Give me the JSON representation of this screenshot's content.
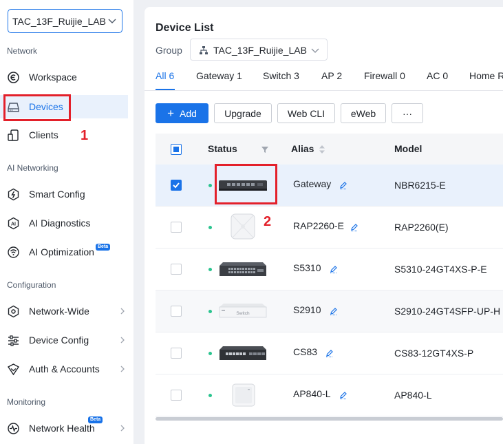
{
  "sidebar": {
    "project": "TAC_13F_Ruijie_LAB",
    "sections": {
      "network": "Network",
      "ai_networking": "AI Networking",
      "configuration": "Configuration",
      "monitoring": "Monitoring"
    },
    "items": {
      "workspace": "Workspace",
      "devices": "Devices",
      "clients": "Clients",
      "smart_config": "Smart Config",
      "ai_diagnostics": "AI Diagnostics",
      "ai_optimization": "AI Optimization",
      "network_wide": "Network-Wide",
      "device_config": "Device Config",
      "auth_accounts": "Auth & Accounts",
      "network_health": "Network Health"
    },
    "beta_label": "Beta"
  },
  "annotations": {
    "step1": "1",
    "step2": "2"
  },
  "main": {
    "title": "Device List",
    "group_label": "Group",
    "group_value": "TAC_13F_Ruijie_LAB",
    "tabs": [
      "All 6",
      "Gateway 1",
      "Switch 3",
      "AP 2",
      "Firewall 0",
      "AC 0",
      "Home R"
    ],
    "active_tab": "All 6",
    "toolbar": {
      "add": "Add",
      "upgrade": "Upgrade",
      "web_cli": "Web CLI",
      "eweb": "eWeb",
      "more": "···"
    },
    "columns": {
      "status": "Status",
      "alias": "Alias",
      "model": "Model"
    },
    "rows": [
      {
        "alias": "Gateway",
        "model": "NBR6215-E",
        "online": true,
        "checked": true,
        "device_type": "gateway"
      },
      {
        "alias": "RAP2260-E",
        "model": "RAP2260(E)",
        "online": true,
        "checked": false,
        "device_type": "ap-ceiling"
      },
      {
        "alias": "S5310",
        "model": "S5310-24GT4XS-P-E",
        "online": true,
        "checked": false,
        "device_type": "switch-dark"
      },
      {
        "alias": "S2910",
        "model": "S2910-24GT4SFP-UP-H",
        "online": true,
        "checked": false,
        "device_type": "switch-white"
      },
      {
        "alias": "CS83",
        "model": "CS83-12GT4XS-P",
        "online": true,
        "checked": false,
        "device_type": "switch-dark"
      },
      {
        "alias": "AP840-L",
        "model": "AP840-L",
        "online": true,
        "checked": false,
        "device_type": "ap-square"
      }
    ],
    "switch_badge": "Switch"
  },
  "colors": {
    "accent": "#1a73e8",
    "annotation_red": "#e3202a",
    "online_green": "#2bc48f"
  }
}
